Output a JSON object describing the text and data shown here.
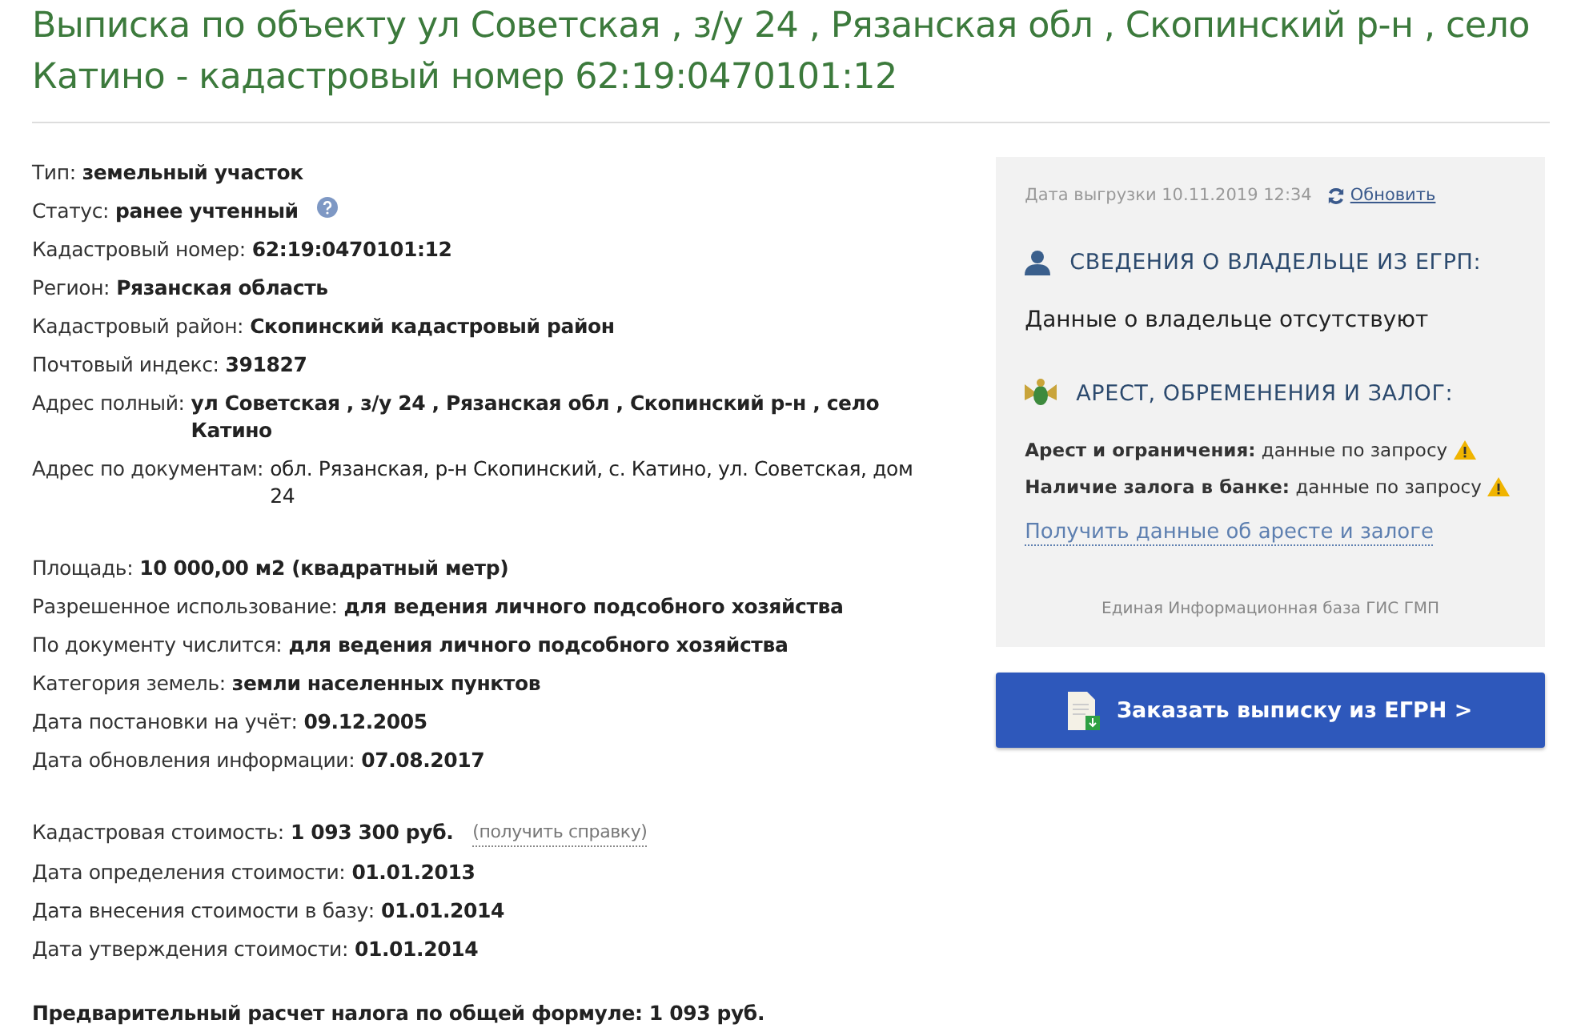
{
  "title": "Выписка по объекту ул Советская , з/у 24 , Рязанская обл , Скопинский р-н , село Катино - кадастровый номер 62:19:0470101:12",
  "groups": [
    {
      "fields": [
        {
          "label": "Тип:",
          "value": "земельный участок",
          "bold": true
        },
        {
          "label": "Статус:",
          "value": "ранее учтенный",
          "bold": true,
          "help": true
        },
        {
          "label": "Кадастровый номер:",
          "value": "62:19:0470101:12",
          "bold": true
        },
        {
          "label": "Регион:",
          "value": "Рязанская область",
          "bold": true
        },
        {
          "label": "Кадастровый район:",
          "value": "Скопинский кадастровый район",
          "bold": true
        },
        {
          "label": "Почтовый индекс:",
          "value": "391827",
          "bold": true
        },
        {
          "label": "Адрес полный:",
          "value": "ул Советская , з/у 24 , Рязанская обл , Скопинский р-н , село Катино",
          "bold": true
        },
        {
          "label": "Адрес по документам:",
          "value": "обл. Рязанская, р-н Скопинский, с. Катино, ул. Советская, дом 24",
          "bold": false
        }
      ]
    },
    {
      "fields": [
        {
          "label": "Площадь:",
          "value": "10 000,00 м2 (квадратный метр)",
          "bold": true
        },
        {
          "label": "Разрешенное использование:",
          "value": "для ведения личного подсобного хозяйства",
          "bold": true
        },
        {
          "label": "По документу числится:",
          "value": "для ведения личного подсобного хозяйства",
          "bold": true
        },
        {
          "label": "Категория земель:",
          "value": "земли населенных пунктов",
          "bold": true
        },
        {
          "label": "Дата постановки на учёт:",
          "value": "09.12.2005",
          "bold": true
        },
        {
          "label": "Дата обновления информации:",
          "value": "07.08.2017",
          "bold": true
        }
      ]
    },
    {
      "fields": [
        {
          "label": "Кадастровая стоимость:",
          "value": "1 093 300 руб.",
          "bold": true,
          "link": "(получить справку)"
        },
        {
          "label": "Дата определения стоимости:",
          "value": "01.01.2013",
          "bold": true
        },
        {
          "label": "Дата внесения стоимости в базу:",
          "value": "01.01.2014",
          "bold": true
        },
        {
          "label": "Дата утверждения стоимости:",
          "value": "01.01.2014",
          "bold": true
        }
      ]
    }
  ],
  "tax_note": "Предварительный расчет налога по общей формуле: 1 093 руб.",
  "panel": {
    "export_date": "Дата выгрузки 10.11.2019 12:34",
    "refresh_link": "Обновить",
    "owner_heading": "СВЕДЕНИЯ О ВЛАДЕЛЬЦЕ ИЗ ЕГРП:",
    "owner_text": "Данные о владельце отсутствуют",
    "arrest_heading": "АРЕСТ, ОБРЕМЕНЕНИЯ И ЗАЛОГ:",
    "arrest_rows": [
      {
        "label": "Арест и ограничения:",
        "value": "данные по запросу"
      },
      {
        "label": "Наличие залога в банке:",
        "value": "данные по запросу"
      }
    ],
    "arrest_link": "Получить данные об аресте и залоге",
    "source": "Единая Информационная база ГИС ГМП"
  },
  "order_button": "Заказать выписку из ЕГРН >"
}
